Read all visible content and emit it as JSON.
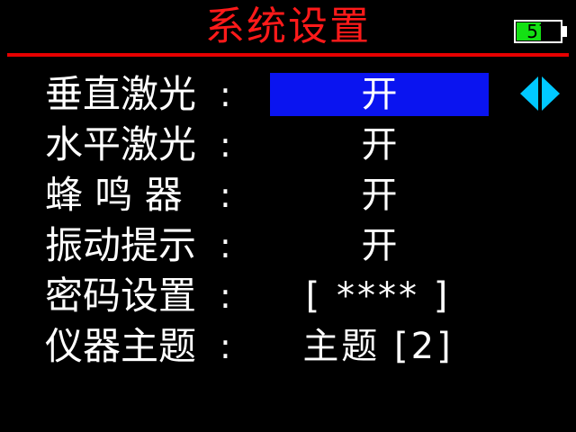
{
  "header": {
    "title": "系统设置",
    "title_color": "#ff1a1a"
  },
  "battery": {
    "text": "57",
    "level_percent": 57,
    "fill_color": "#14e014"
  },
  "menu": {
    "items": [
      {
        "label": "垂直激光",
        "colon": ":",
        "value": "开",
        "selected": true
      },
      {
        "label": "水平激光",
        "colon": ":",
        "value": "开",
        "selected": false
      },
      {
        "label": "蜂 鸣 器",
        "colon": ":",
        "value": "开",
        "selected": false
      },
      {
        "label": "振动提示",
        "colon": ":",
        "value": "开",
        "selected": false
      },
      {
        "label": "密码设置",
        "colon": ":",
        "value": "[ **** ]",
        "selected": false
      },
      {
        "label": "仪器主题",
        "colon": ":",
        "value": "主题 [2]",
        "selected": false
      }
    ],
    "selection_color": "#0a14f0",
    "arrows_icon": "left-right-arrows-icon",
    "arrows_color": "#00c8ff"
  }
}
